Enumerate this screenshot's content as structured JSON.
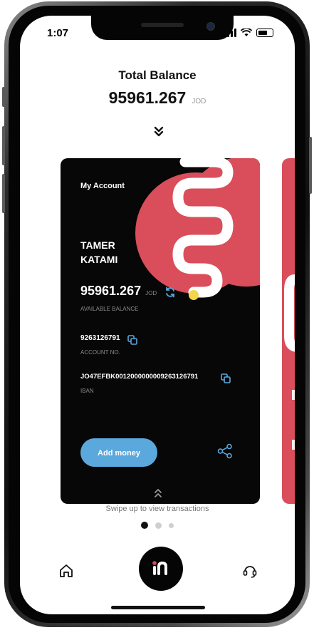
{
  "status_bar": {
    "time": "1:07"
  },
  "summary": {
    "label": "Total Balance",
    "amount": "95961.267",
    "currency": "JOD"
  },
  "card": {
    "title": "My Account",
    "holder_first": "TAMER",
    "holder_last": "KATAMI",
    "balance": "95961.267",
    "currency": "JOD",
    "balance_label": "AVAILABLE BALANCE",
    "account_number": "9263126791",
    "account_label": "ACCOUNT NO.",
    "iban": "JO47EFBK0012000000009263126791",
    "iban_label": "IBAN",
    "add_money_label": "Add money"
  },
  "swipe_hint": "Swipe up to view transactions",
  "pagination": {
    "count": 3,
    "active": 0
  },
  "icons": {
    "down": "double-chevron-down-icon",
    "up": "double-chevron-up-icon",
    "refresh": "refresh-icon",
    "copy": "copy-icon",
    "share": "share-icon",
    "home": "home-icon",
    "logo": "app-logo-icon",
    "support": "headset-icon"
  },
  "colors": {
    "card_bg": "#070707",
    "accent_red": "#d94e5a",
    "accent_blue": "#5ba8dc",
    "accent_yellow": "#f2d64b"
  }
}
